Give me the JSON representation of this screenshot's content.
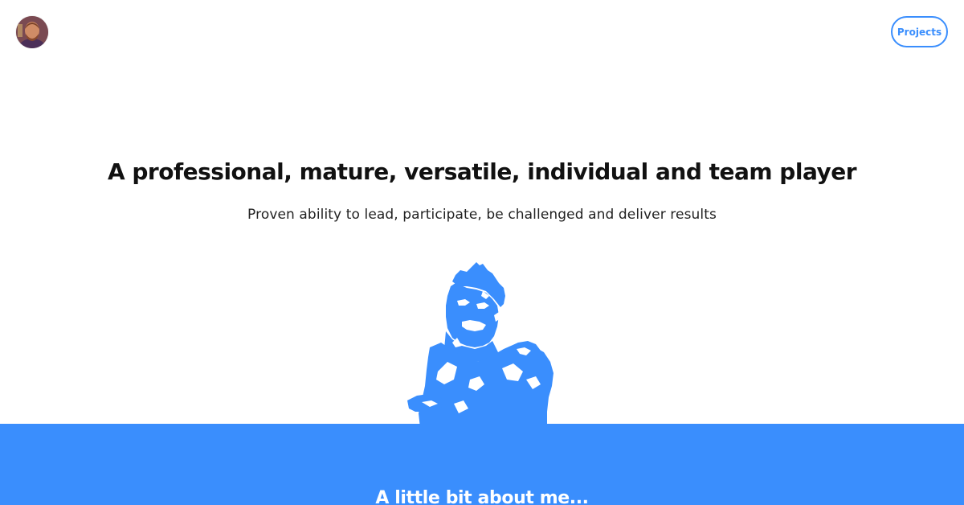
{
  "header": {
    "avatar_icon": "profile-photo-avatar",
    "projects_label": "Projects"
  },
  "hero": {
    "title": "A professional, mature, versatile, individual and team player",
    "subtitle": "Proven ability to lead, participate, be challenged and deliver results",
    "portrait_icon": "portrait-illustration"
  },
  "about": {
    "heading": "A little bit about me..."
  },
  "colors": {
    "accent": "#3a8efd",
    "text": "#111111",
    "background": "#ffffff"
  }
}
